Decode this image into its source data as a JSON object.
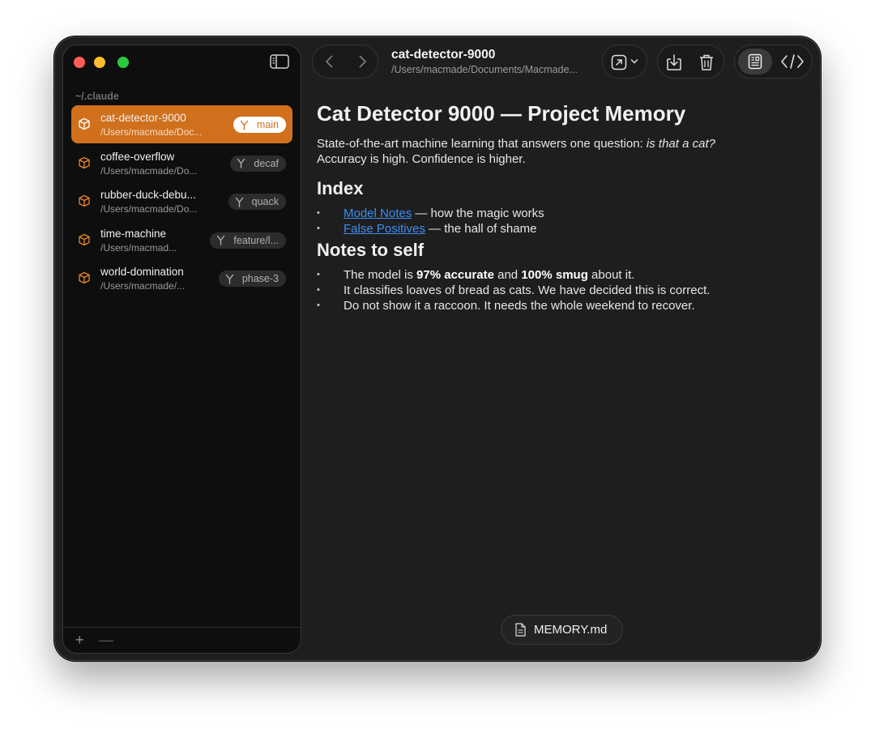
{
  "sidebar": {
    "section_label": "~/.claude",
    "projects": [
      {
        "name": "cat-detector-9000",
        "path": "/Users/macmade/Doc...",
        "branch": "main",
        "active": true
      },
      {
        "name": "coffee-overflow",
        "path": "/Users/macmade/Do...",
        "branch": "decaf",
        "active": false
      },
      {
        "name": "rubber-duck-debu...",
        "path": "/Users/macmade/Do...",
        "branch": "quack",
        "active": false
      },
      {
        "name": "time-machine",
        "path": "/Users/macmad...",
        "branch": "feature/l...",
        "active": false
      },
      {
        "name": "world-domination",
        "path": "/Users/macmade/...",
        "branch": "phase-3",
        "active": false
      }
    ],
    "add_label": "+",
    "remove_label": "—"
  },
  "header": {
    "title": "cat-detector-9000",
    "subtitle": "/Users/macmade/Documents/Macmade..."
  },
  "document": {
    "h1": "Cat Detector 9000 — Project Memory",
    "intro_part1": "State-of-the-art machine learning that answers one question: ",
    "intro_em": "is that a cat?",
    "intro_line2": "Accuracy is high. Confidence is higher.",
    "index_heading": "Index",
    "index_items": [
      {
        "link": "Model Notes",
        "text": " — how the magic works"
      },
      {
        "link": "False Positives",
        "text": " — the hall of shame"
      }
    ],
    "notes_heading": "Notes to self",
    "note1_a": "The model is ",
    "note1_b1": "97% accurate",
    "note1_c": " and ",
    "note1_b2": "100% smug",
    "note1_d": " about it.",
    "note2": "It classifies loaves of bread as cats. We have decided this is correct.",
    "note3": "Do not show it a raccoon. It needs the whole weekend to recover."
  },
  "footer": {
    "file_name": "MEMORY.md"
  },
  "colors": {
    "accent": "#d0701d",
    "link": "#3d8ef5"
  }
}
